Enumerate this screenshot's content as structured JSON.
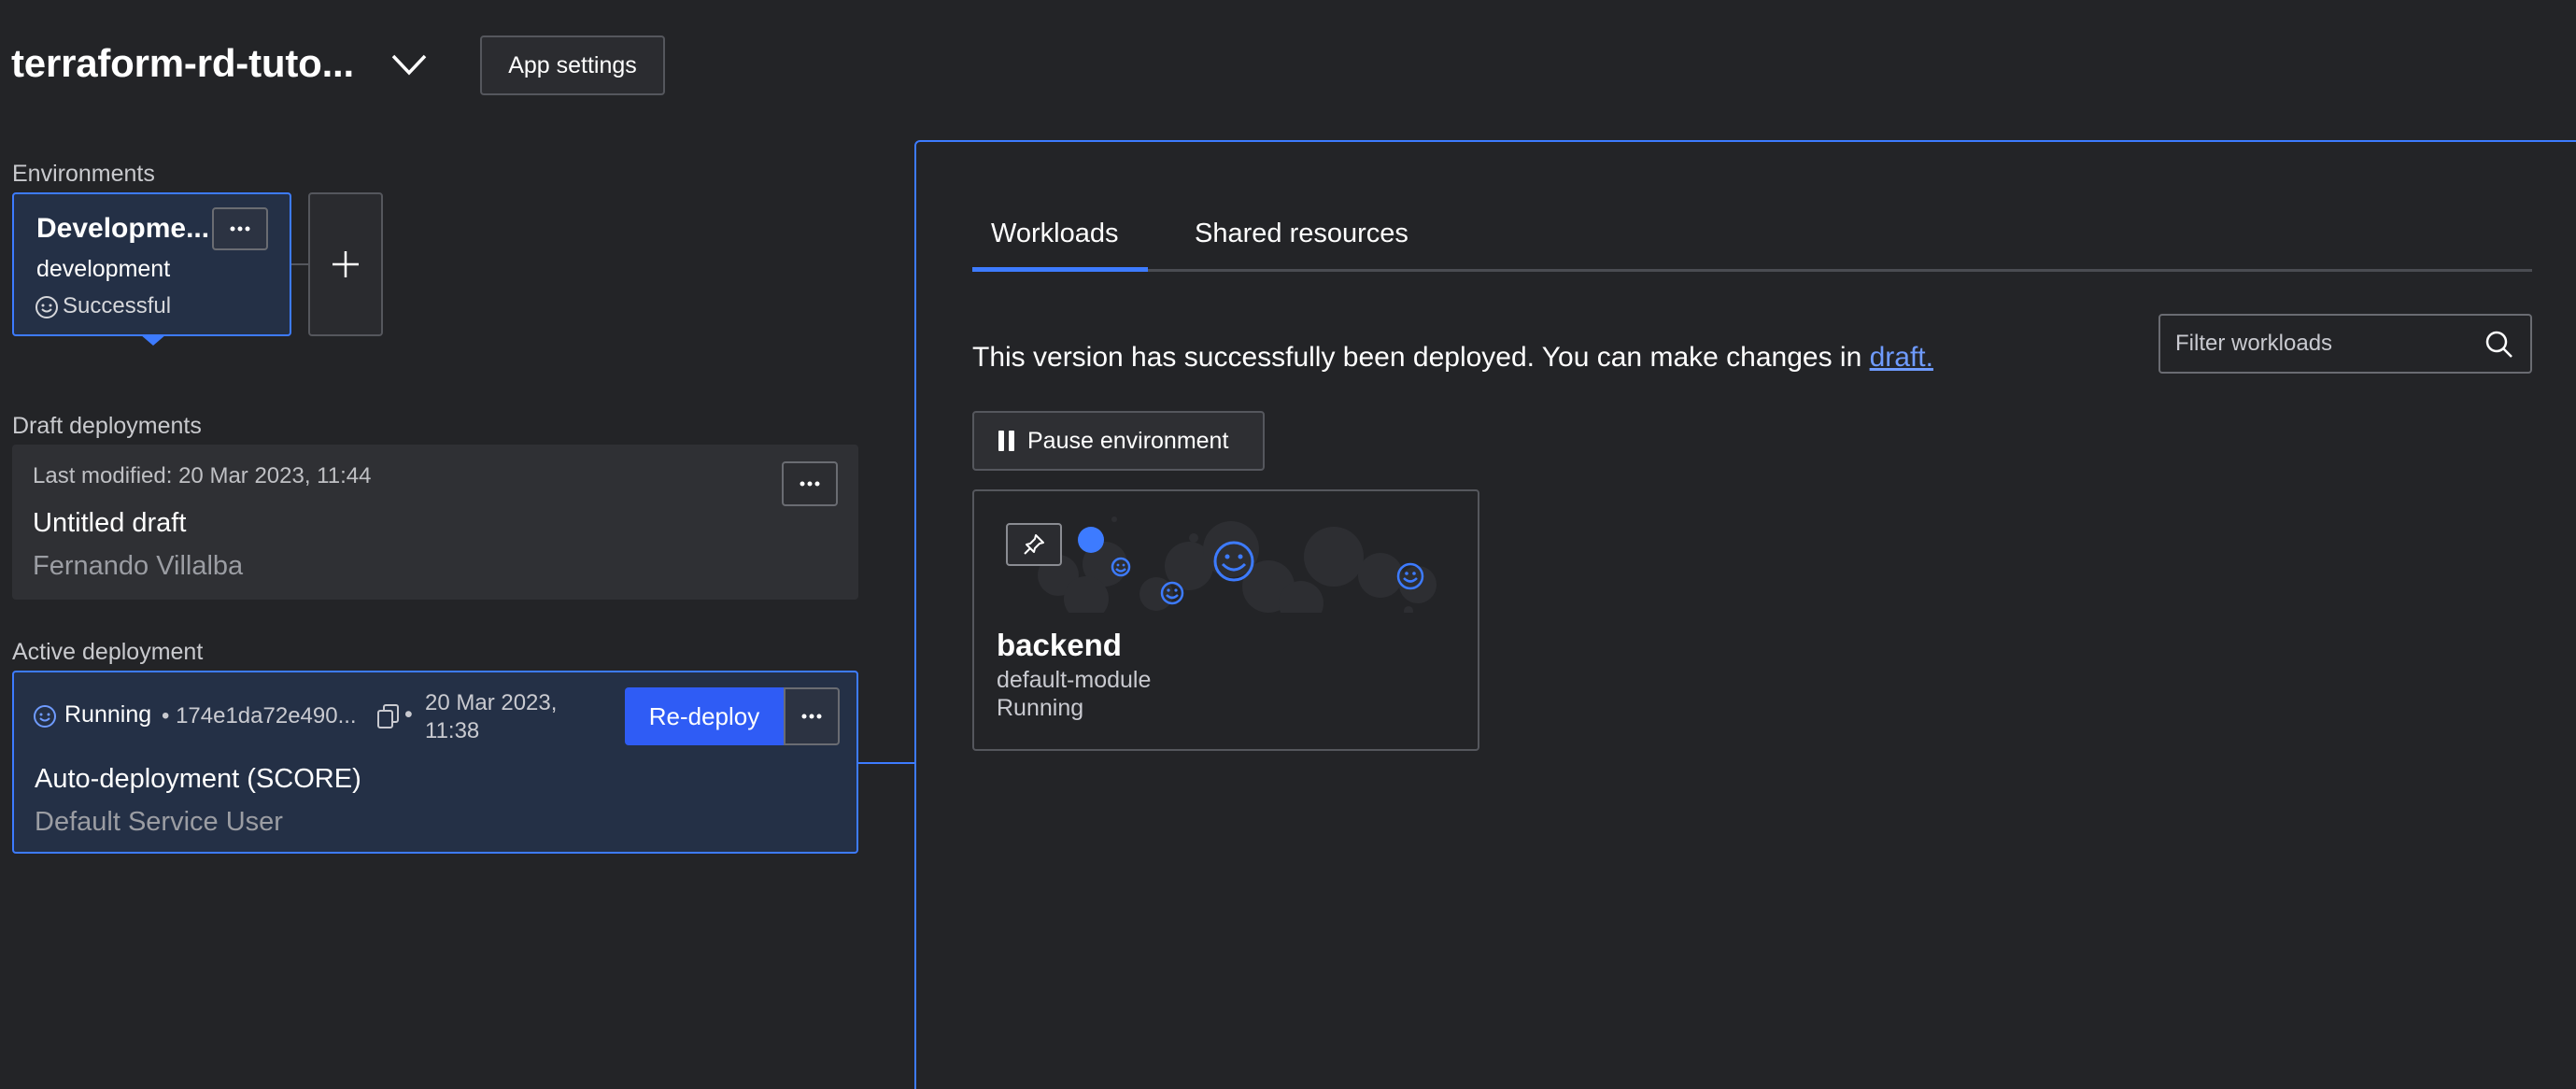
{
  "header": {
    "app_title": "terraform-rd-tuto...",
    "app_settings_label": "App settings"
  },
  "environments": {
    "section_label": "Environments",
    "card": {
      "title": "Developme...",
      "env_id": "development",
      "status": "Successful"
    }
  },
  "drafts": {
    "section_label": "Draft deployments",
    "last_modified": "Last modified: 20 Mar 2023, 11:44",
    "title": "Untitled draft",
    "author": "Fernando Villalba"
  },
  "active": {
    "section_label": "Active deployment",
    "status": "Running",
    "hash": "• 174e1da72e490...",
    "separator": "•",
    "date": "20 Mar 2023, 11:38",
    "redeploy_label": "Re-deploy",
    "title": "Auto-deployment (SCORE)",
    "user": "Default Service User"
  },
  "panel": {
    "tabs": [
      {
        "label": "Workloads",
        "active": true
      },
      {
        "label": "Shared resources",
        "active": false
      }
    ],
    "info_text": "This version has successfully been deployed. You can make changes in ",
    "info_link": "draft.",
    "filter_placeholder": "Filter workloads",
    "pause_label": "Pause environment",
    "workloads": [
      {
        "name": "backend",
        "module": "default-module",
        "status": "Running"
      }
    ]
  },
  "colors": {
    "accent": "#3d7bff",
    "primary_button": "#2f5cf5",
    "background": "#232427",
    "selected_card": "#243046"
  },
  "icons": {
    "title_dropdown": "chevron-down-icon",
    "env_status": "smiley-icon",
    "more": "ellipsis-icon",
    "add": "plus-icon",
    "copy": "copy-icon",
    "search": "search-icon",
    "pause": "pause-icon",
    "pin": "pin-icon"
  }
}
